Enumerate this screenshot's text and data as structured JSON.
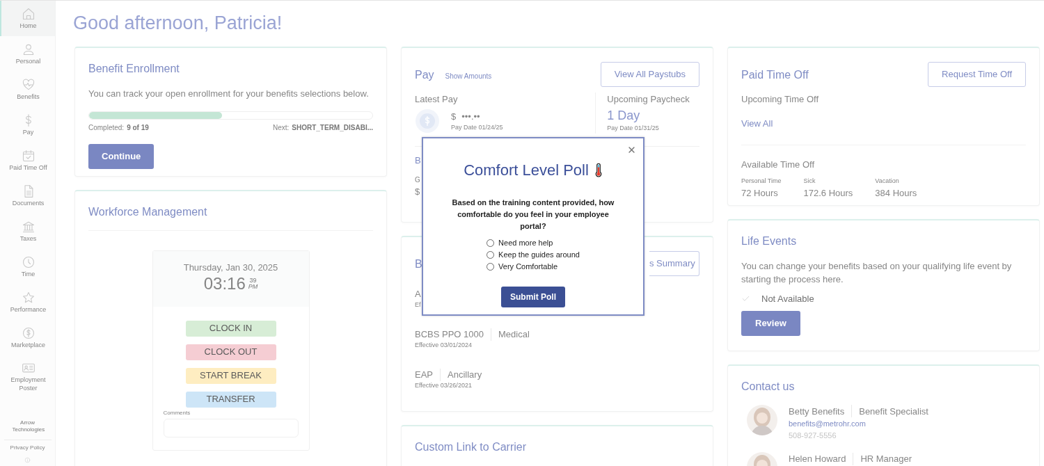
{
  "sidebar": {
    "items": [
      {
        "label": "Home",
        "selected": true
      },
      {
        "label": "Personal",
        "selected": false
      },
      {
        "label": "Benefits",
        "selected": false
      },
      {
        "label": "Pay",
        "selected": false
      },
      {
        "label": "Paid Time Off",
        "selected": false
      },
      {
        "label": "Documents",
        "selected": false
      },
      {
        "label": "Taxes",
        "selected": false
      },
      {
        "label": "Time",
        "selected": false
      },
      {
        "label": "Performance",
        "selected": false
      },
      {
        "label": "Marketplace",
        "selected": false
      },
      {
        "label": "Employment Poster",
        "selected": false
      }
    ],
    "company": "Arrow Technologies",
    "footer_link": "Privacy Policy"
  },
  "greeting": "Good afternoon, Patricia!",
  "benefit_enrollment": {
    "title": "Benefit Enrollment",
    "description": "You can track your open enrollment for your benefits selections below.",
    "level": 0.47,
    "completed_label": "Completed:",
    "completed_value": "9 of 19",
    "next_label": "Next:",
    "next_value": "SHORT_TERM_DISABI...",
    "button": "Continue"
  },
  "workforce": {
    "title": "Workforce Management",
    "date": "Thursday, Jan 30, 2025",
    "time": "03:16",
    "seconds": "39",
    "meridiem": "PM",
    "buttons": [
      {
        "label": "CLOCK IN",
        "color": "#d7edd6"
      },
      {
        "label": "CLOCK OUT",
        "color": "#f5cdd3"
      },
      {
        "label": "START BREAK",
        "color": "#feedc1"
      },
      {
        "label": "TRANSFER",
        "color": "#cde5f7"
      }
    ],
    "comments_label": "Comments"
  },
  "pay": {
    "title": "Pay",
    "show_amounts": "Show Amounts",
    "button": "View All Paystubs",
    "latest_label": "Latest Pay",
    "currency": "$",
    "amount": "•••.••",
    "pay_date": "Pay Date 01/24/25",
    "upcoming_label": "Upcoming Paycheck",
    "upcoming_value": "1 Day",
    "upcoming_date": "Pay Date 01/31/25",
    "section_fragment": "B",
    "label_fragment": "G",
    "value_fragment": "$"
  },
  "benefits": {
    "title_fragment": "B",
    "button_fragment": "s Summary",
    "plans": [
      {
        "name": "A",
        "effective": "Ef"
      },
      {
        "name": "BCBS PPO 1000",
        "type": "Medical",
        "effective": "Effective 03/01/2024"
      },
      {
        "name": "EAP",
        "type": "Ancillary",
        "effective": "Effective 03/26/2021"
      }
    ]
  },
  "custom_link": {
    "title": "Custom Link to Carrier"
  },
  "pto": {
    "title": "Paid Time Off",
    "button": "Request Time Off",
    "upcoming_label": "Upcoming Time Off",
    "view_all": "View All",
    "available_label": "Available Time Off",
    "balances": [
      {
        "label": "Personal Time",
        "value": "72 Hours"
      },
      {
        "label": "Sick",
        "value": "172.6 Hours"
      },
      {
        "label": "Vacation",
        "value": "384 Hours"
      }
    ]
  },
  "life_events": {
    "title": "Life Events",
    "description": "You can change your benefits based on your qualifying life event by starting the process here.",
    "status": "Not Available",
    "button": "Review"
  },
  "contact": {
    "title": "Contact us",
    "contacts": [
      {
        "name": "Betty Benefits",
        "role": "Benefit Specialist",
        "email": "benefits@metrohr.com",
        "phone": "508-927-5556"
      },
      {
        "name": "Helen Howard",
        "role": "HR Manager"
      }
    ]
  },
  "modal": {
    "title": "Comfort Level Poll",
    "question": "Based on the training content provided, how comfortable do you feel in your employee portal?",
    "options": [
      {
        "label": "Need more help",
        "selected": false
      },
      {
        "label": "Keep the guides around",
        "selected": false
      },
      {
        "label": "Very Comfortable",
        "selected": false
      }
    ],
    "submit": "Submit Poll"
  }
}
